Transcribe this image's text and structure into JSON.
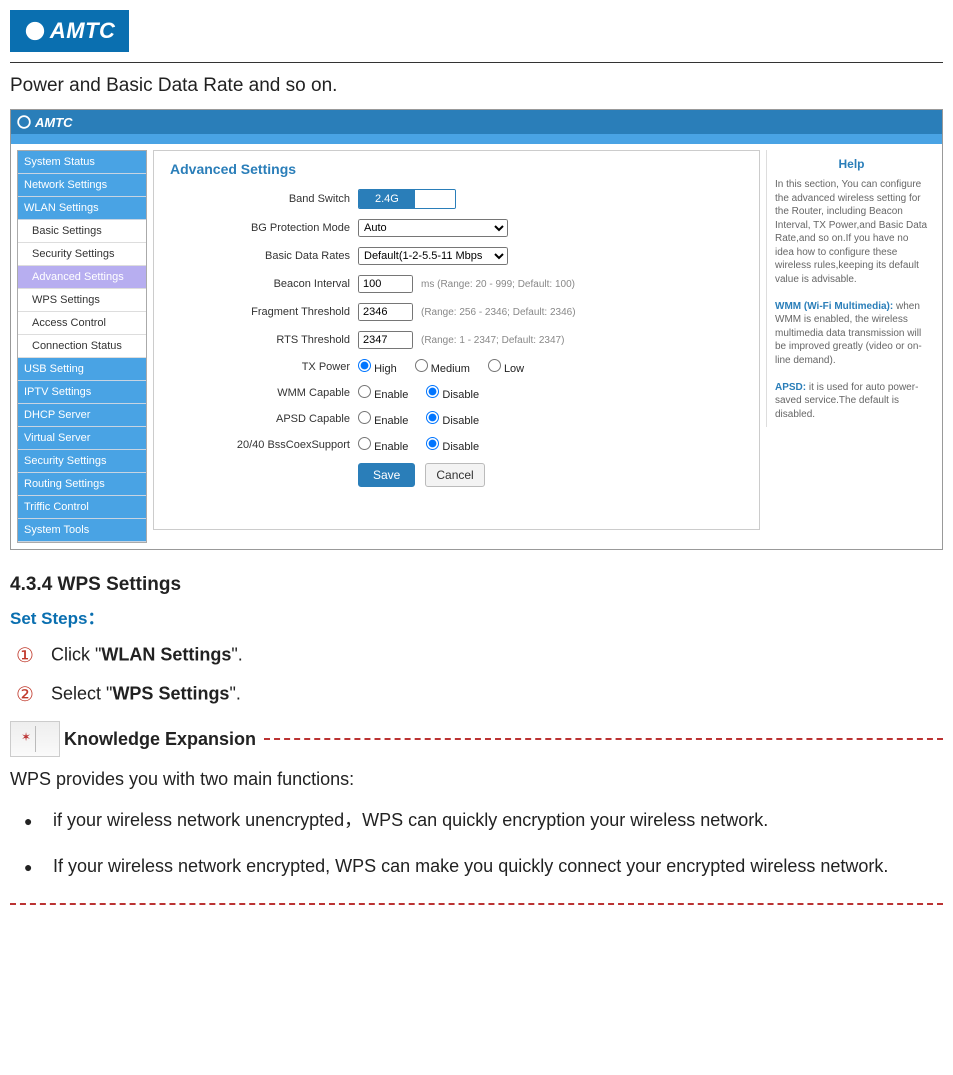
{
  "logo_text": "AMTC",
  "lead": "Power and Basic Data Rate and so on.",
  "shot": {
    "logo": "AMTC",
    "sidebar": [
      {
        "label": "System Status",
        "type": "top"
      },
      {
        "label": "Network Settings",
        "type": "top"
      },
      {
        "label": "WLAN Settings",
        "type": "top"
      },
      {
        "label": "Basic Settings",
        "type": "sub"
      },
      {
        "label": "Security Settings",
        "type": "sub"
      },
      {
        "label": "Advanced Settings",
        "type": "sel"
      },
      {
        "label": "WPS Settings",
        "type": "sub"
      },
      {
        "label": "Access Control",
        "type": "sub"
      },
      {
        "label": "Connection Status",
        "type": "sub"
      },
      {
        "label": "USB Setting",
        "type": "top"
      },
      {
        "label": "IPTV Settings",
        "type": "top"
      },
      {
        "label": "DHCP Server",
        "type": "top"
      },
      {
        "label": "Virtual Server",
        "type": "top"
      },
      {
        "label": "Security Settings",
        "type": "top"
      },
      {
        "label": "Routing Settings",
        "type": "top"
      },
      {
        "label": "Triffic Control",
        "type": "top"
      },
      {
        "label": "System Tools",
        "type": "top"
      }
    ],
    "panel_title": "Advanced Settings",
    "fields": {
      "band_switch": {
        "label": "Band Switch",
        "active": "2.4G",
        "inactive": ""
      },
      "bg_mode": {
        "label": "BG Protection Mode",
        "value": "Auto"
      },
      "data_rates": {
        "label": "Basic Data Rates",
        "value": "Default(1-2-5.5-11 Mbps"
      },
      "beacon": {
        "label": "Beacon Interval",
        "value": "100",
        "hint": "ms (Range: 20 - 999; Default: 100)"
      },
      "frag": {
        "label": "Fragment Threshold",
        "value": "2346",
        "hint": "(Range: 256 - 2346; Default: 2346)"
      },
      "rts": {
        "label": "RTS Threshold",
        "value": "2347",
        "hint": "(Range: 1 - 2347; Default: 2347)"
      },
      "tx": {
        "label": "TX Power",
        "options": [
          "High",
          "Medium",
          "Low"
        ],
        "checked": 0
      },
      "wmm": {
        "label": "WMM Capable",
        "options": [
          "Enable",
          "Disable"
        ],
        "checked": 1
      },
      "apsd": {
        "label": "APSD Capable",
        "options": [
          "Enable",
          "Disable"
        ],
        "checked": 1
      },
      "coex": {
        "label": "20/40 BssCoexSupport",
        "options": [
          "Enable",
          "Disable"
        ],
        "checked": 1
      }
    },
    "buttons": {
      "save": "Save",
      "cancel": "Cancel"
    },
    "help": {
      "title": "Help",
      "p1": "In this section, You can configure the advanced wireless setting for the Router, including Beacon Interval, TX Power,and Basic Data Rate,and so on.If you have no idea how to configure these wireless rules,keeping its default value is advisable.",
      "p2a": "WMM (Wi-Fi Multimedia):",
      "p2b": " when WMM is enabled, the wireless multimedia data transmission will be improved greatly (video or on-line demand).",
      "p3a": "APSD:",
      "p3b": " it is used for auto power-saved service.The default is disabled."
    }
  },
  "section_heading": "4.3.4 WPS Settings",
  "set_steps_label": "Set Steps：",
  "steps": [
    {
      "circ": "①",
      "pre": "Click \"",
      "bold": "WLAN Settings",
      "post": "\"."
    },
    {
      "circ": "②",
      "pre": "Select \"",
      "bold": "WPS Settings",
      "post": "\"."
    }
  ],
  "ke_label": "Knowledge Expansion",
  "ke_intro": "WPS provides you with two main functions:",
  "ke_bullets": [
    " if your wireless network unencrypted，WPS can quickly encryption your wireless network.",
    "If your wireless network encrypted, WPS can make you quickly connect your encrypted wireless network."
  ]
}
